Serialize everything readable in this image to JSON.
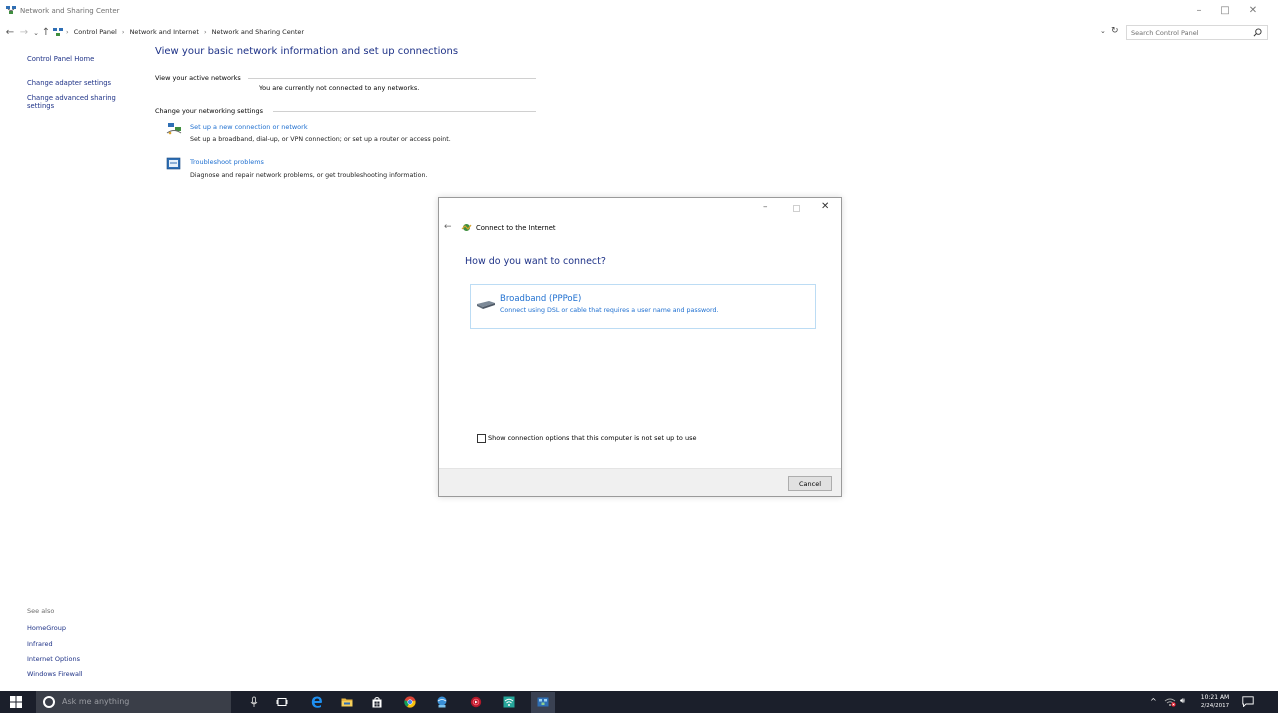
{
  "window": {
    "title": "Network and Sharing Center",
    "controls": {
      "minimize": "–",
      "maximize": "□",
      "close": "✕"
    }
  },
  "address_bar": {
    "breadcrumb": [
      "Control Panel",
      "Network and Internet",
      "Network and Sharing Center"
    ],
    "separator": "›",
    "search_placeholder": "Search Control Panel"
  },
  "left_nav": {
    "home": "Control Panel Home",
    "links": [
      "Change adapter settings",
      "Change advanced sharing",
      "settings"
    ],
    "see_also_label": "See also",
    "see_also": [
      "HomeGroup",
      "Infrared",
      "Internet Options",
      "Windows Firewall"
    ]
  },
  "main": {
    "title": "View your basic network information and set up connections",
    "active_networks_label": "View your active networks",
    "active_networks_status": "You are currently not connected to any networks.",
    "settings_label": "Change your networking settings",
    "tasks": [
      {
        "link": "Set up a new connection or network",
        "desc": "Set up a broadband, dial-up, or VPN connection; or set up a router or access point."
      },
      {
        "link": "Troubleshoot problems",
        "desc": "Diagnose and repair network problems, or get troubleshooting information."
      }
    ]
  },
  "dialog": {
    "title": "Connect to the Internet",
    "question": "How do you want to connect?",
    "option": {
      "title": "Broadband (PPPoE)",
      "desc": "Connect using DSL or cable that requires a user name and password."
    },
    "checkbox_label": "Show connection options that this computer is not set up to use",
    "checkbox_checked": false,
    "cancel_label": "Cancel"
  },
  "taskbar": {
    "search_placeholder": "Ask me anything",
    "clock_time": "10:21 AM",
    "clock_date": "2/24/2017"
  },
  "colors": {
    "link_dark": "#1e3287",
    "link_blue": "#1e6fd0",
    "taskbar": "#1b1f2b"
  }
}
